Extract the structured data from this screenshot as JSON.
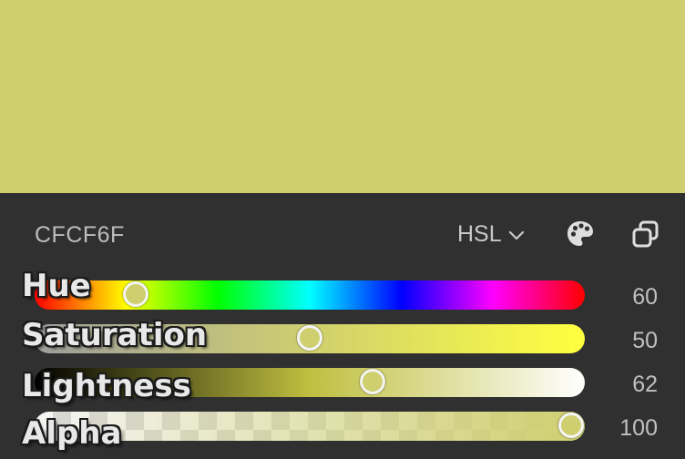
{
  "color": {
    "hex_label": "CFCF6F",
    "swatch": "#cfcf6f"
  },
  "toolbar": {
    "mode_label": "HSL",
    "mode_icon": "chevron-down-icon",
    "palette_icon": "palette-icon",
    "copy_icon": "copy-icon"
  },
  "sliders": [
    {
      "label": "Hue",
      "value": "60",
      "position": 0.167
    },
    {
      "label": "Saturation",
      "value": "50",
      "position": 0.5
    },
    {
      "label": "Lightness",
      "value": "62",
      "position": 0.62
    },
    {
      "label": "Alpha",
      "value": "100",
      "position": 1.0
    }
  ]
}
